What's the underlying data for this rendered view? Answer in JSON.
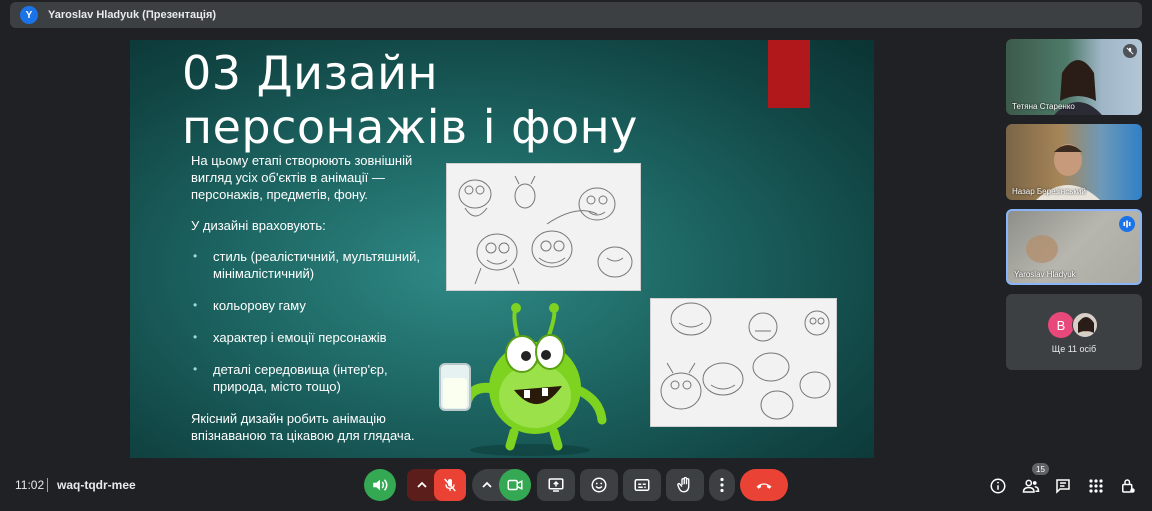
{
  "presenter_bar": {
    "avatar_letter": "Y",
    "title": "Yaroslav Hladyuk (Презентація)"
  },
  "slide": {
    "title": "03 Дизайн персонажів і фону",
    "intro": "На цьому етапі створюють зовнішній вигляд усіх об'єктів в анімації — персонажів, предметів, фону.",
    "list_heading": "У дизайні враховують:",
    "bullets": [
      "стиль (реалістичний, мультяшний, мінімалістичний)",
      "кольорову гаму",
      "характер і емоції персонажів",
      "деталі середовища (інтер'єр, природа, місто тощо)"
    ],
    "conclusion": "Якісний дизайн робить анімацію впізнаваною та цікавою для глядача.",
    "colors": {
      "background": "#1d6663",
      "accent_red": "#b0181c",
      "monster_green": "#7ed321"
    }
  },
  "participants": [
    {
      "name": "Тетяна Старенко",
      "muted": true
    },
    {
      "name": "Назар Березінський",
      "muted": false
    },
    {
      "name": "Yaroslav Hladyuk",
      "speaking": true
    },
    {
      "more_avatar_letter": "B",
      "more_label": "Ще 11 осіб"
    }
  ],
  "bottom_bar": {
    "time": "11:02",
    "meeting_code": "waq-tqdr-mee",
    "people_count": "15",
    "controls": [
      "speaker-icon",
      "mic-off-icon",
      "camera-icon",
      "present-icon",
      "emoji-icon",
      "captions-icon",
      "raise-hand-icon",
      "more-icon",
      "leave-call-icon"
    ],
    "right_icons": [
      "info-icon",
      "people-icon",
      "chat-icon",
      "activities-icon",
      "host-controls-icon"
    ],
    "colors": {
      "green": "#34a853",
      "red": "#ea4335",
      "dark": "#3c4043"
    }
  }
}
